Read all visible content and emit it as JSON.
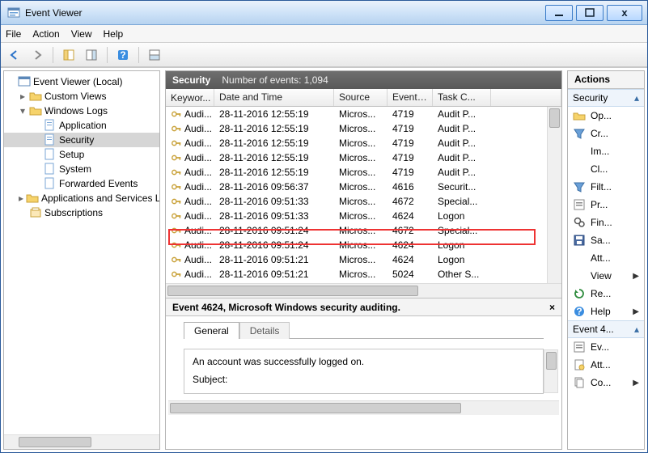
{
  "window": {
    "title": "Event Viewer"
  },
  "menu": {
    "file": "File",
    "action": "Action",
    "view": "View",
    "help": "Help"
  },
  "tree": {
    "root": "Event Viewer (Local)",
    "custom_views": "Custom Views",
    "windows_logs": "Windows Logs",
    "application": "Application",
    "security": "Security",
    "setup": "Setup",
    "system": "System",
    "forwarded": "Forwarded Events",
    "apps_services": "Applications and Services Lo",
    "subscriptions": "Subscriptions"
  },
  "middle": {
    "header_title": "Security",
    "header_sub": "Number of events: 1,094",
    "columns": {
      "keywords": "Keywor...",
      "datetime": "Date and Time",
      "source": "Source",
      "eventid": "Event ID",
      "task": "Task C..."
    },
    "rows": [
      {
        "kw": "Audi...",
        "dt": "28-11-2016 12:55:19",
        "src": "Micros...",
        "id": "4719",
        "task": "Audit P..."
      },
      {
        "kw": "Audi...",
        "dt": "28-11-2016 12:55:19",
        "src": "Micros...",
        "id": "4719",
        "task": "Audit P..."
      },
      {
        "kw": "Audi...",
        "dt": "28-11-2016 12:55:19",
        "src": "Micros...",
        "id": "4719",
        "task": "Audit P..."
      },
      {
        "kw": "Audi...",
        "dt": "28-11-2016 12:55:19",
        "src": "Micros...",
        "id": "4719",
        "task": "Audit P..."
      },
      {
        "kw": "Audi...",
        "dt": "28-11-2016 12:55:19",
        "src": "Micros...",
        "id": "4719",
        "task": "Audit P..."
      },
      {
        "kw": "Audi...",
        "dt": "28-11-2016 09:56:37",
        "src": "Micros...",
        "id": "4616",
        "task": "Securit..."
      },
      {
        "kw": "Audi...",
        "dt": "28-11-2016 09:51:33",
        "src": "Micros...",
        "id": "4672",
        "task": "Special..."
      },
      {
        "kw": "Audi...",
        "dt": "28-11-2016 09:51:33",
        "src": "Micros...",
        "id": "4624",
        "task": "Logon"
      },
      {
        "kw": "Audi...",
        "dt": "28-11-2016 09:51:24",
        "src": "Micros...",
        "id": "4672",
        "task": "Special..."
      },
      {
        "kw": "Audi...",
        "dt": "28-11-2016 09:51:24",
        "src": "Micros...",
        "id": "4624",
        "task": "Logon"
      },
      {
        "kw": "Audi...",
        "dt": "28-11-2016 09:51:21",
        "src": "Micros...",
        "id": "4624",
        "task": "Logon"
      },
      {
        "kw": "Audi...",
        "dt": "28-11-2016 09:51:21",
        "src": "Micros...",
        "id": "5024",
        "task": "Other S..."
      }
    ],
    "detail_title": "Event 4624, Microsoft Windows security auditing.",
    "tab_general": "General",
    "tab_details": "Details",
    "detail_line1": "An account was successfully logged on.",
    "detail_line2": "Subject:"
  },
  "actions": {
    "title": "Actions",
    "sec1": "Security",
    "items1": [
      {
        "icon": "folder-open-icon",
        "label": "Op..."
      },
      {
        "icon": "filter-icon",
        "label": "Cr..."
      },
      {
        "icon": "blank-icon",
        "label": "Im..."
      },
      {
        "icon": "blank-icon",
        "label": "Cl..."
      },
      {
        "icon": "filter-icon",
        "label": "Filt..."
      },
      {
        "icon": "properties-icon",
        "label": "Pr..."
      },
      {
        "icon": "find-icon",
        "label": "Fin..."
      },
      {
        "icon": "save-icon",
        "label": "Sa..."
      },
      {
        "icon": "blank-icon",
        "label": "Att..."
      },
      {
        "icon": "blank-icon",
        "label": "View",
        "arrow": true
      },
      {
        "icon": "refresh-icon",
        "label": "Re..."
      },
      {
        "icon": "help-icon",
        "label": "Help",
        "arrow": true
      }
    ],
    "sec2": "Event 4...",
    "items2": [
      {
        "icon": "properties-icon",
        "label": "Ev..."
      },
      {
        "icon": "attach-icon",
        "label": "Att..."
      },
      {
        "icon": "copy-icon",
        "label": "Co...",
        "arrow": true
      }
    ]
  }
}
